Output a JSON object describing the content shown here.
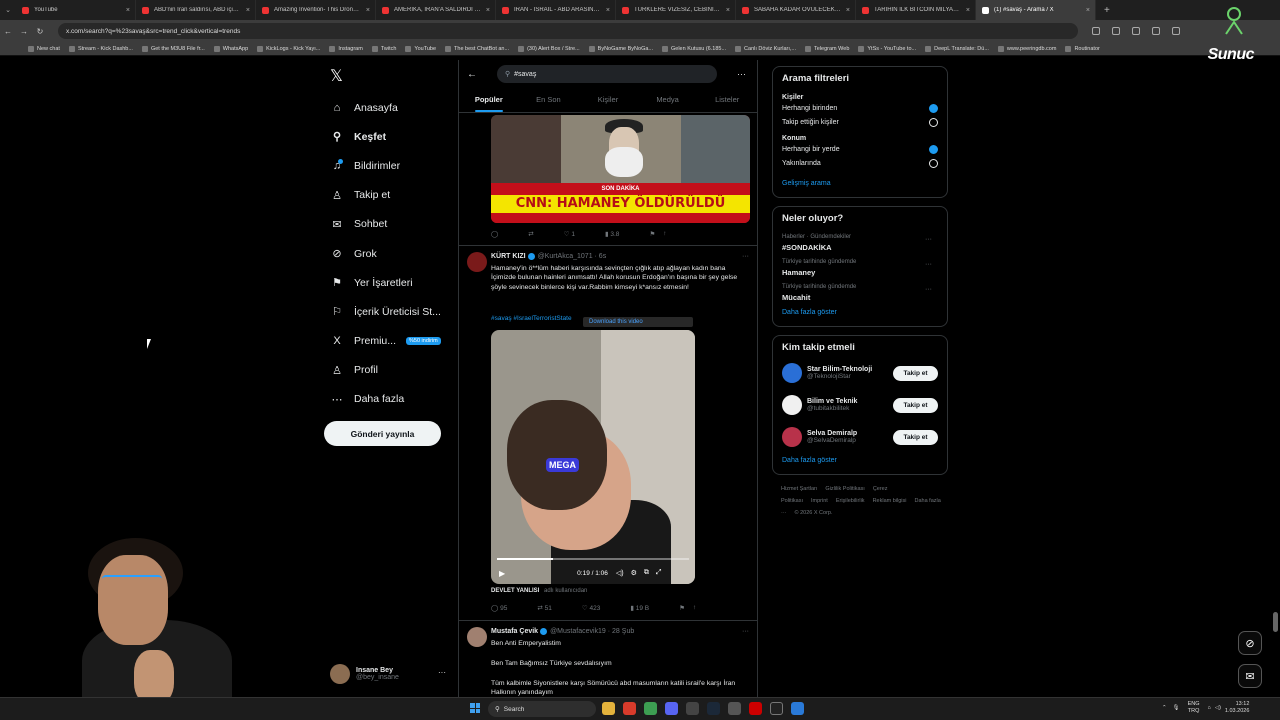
{
  "browser": {
    "tabs": [
      {
        "label": "YouTube",
        "icon": "youtube-icon"
      },
      {
        "label": "ABD'nin İran saldırısı, ABD için a...",
        "icon": "youtube-icon"
      },
      {
        "label": "Amazing Invention- This Drone ...",
        "icon": "youtube-icon"
      },
      {
        "label": "AMERİKA, İRAN'A SALDIRDI | T...",
        "icon": "youtube-icon"
      },
      {
        "label": "İRAN - İSRAİL - ABD ARASINDA...",
        "icon": "youtube-icon"
      },
      {
        "label": "TÜRKLERE VİZESİZ, CEBİNİZİ YO...",
        "icon": "youtube-icon"
      },
      {
        "label": "SABAHA KADAR ÖVÜLECEK OY...",
        "icon": "youtube-icon"
      },
      {
        "label": "TARİHİN İLK BİTCOİN MİLYARDE...",
        "icon": "youtube-icon"
      },
      {
        "label": "(1) #savaş - Arama / X",
        "icon": "x-icon",
        "active": true
      }
    ],
    "url": "x.com/search?q=%23savaş&src=trend_click&vertical=trends",
    "bookmarks": [
      "New chat",
      "Stream - Kick Dashb...",
      "Get the M3U8 File fr...",
      "WhatsApp",
      "KickLogs - Kick Yayı...",
      "Instagram",
      "Twitch",
      "YouTube",
      "The best ChatBot an...",
      "(30) Alert Box / Stre...",
      "ByNoGame ByNoGa...",
      "Gelen Kutusu (6.185...",
      "Canlı Döviz Kurları,...",
      "Telegram Web",
      "YtSs - YouTube to...",
      "DeepL Translate: Dü...",
      "www.peeringdb.com",
      "Routinator"
    ]
  },
  "overlay": {
    "brand": "Sunuc"
  },
  "nav": {
    "items": [
      {
        "label": "Anasayfa",
        "icon": "home-icon",
        "glyph": "⌂"
      },
      {
        "label": "Keşfet",
        "icon": "search-icon",
        "glyph": "⚲",
        "active": true
      },
      {
        "label": "Bildirimler",
        "icon": "bell-icon",
        "glyph": "♫"
      },
      {
        "label": "Takip et",
        "icon": "follow-icon",
        "glyph": "♙"
      },
      {
        "label": "Sohbet",
        "icon": "mail-icon",
        "glyph": "✉"
      },
      {
        "label": "Grok",
        "icon": "grok-icon",
        "glyph": "⊘"
      },
      {
        "label": "Yer İşaretleri",
        "icon": "bookmark-icon",
        "glyph": "⚑"
      },
      {
        "label": "İçerik Üreticisi St...",
        "icon": "creator-icon",
        "glyph": "⚐"
      },
      {
        "label": "Premiu...",
        "icon": "x-premium-icon",
        "glyph": "X",
        "badge": "%50 indirim"
      },
      {
        "label": "Profil",
        "icon": "profile-icon",
        "glyph": "♙"
      },
      {
        "label": "Daha fazla",
        "icon": "more-icon",
        "glyph": "⋯"
      }
    ],
    "post_button": "Gönderi yayınla",
    "user": {
      "name": "Insane Bey",
      "handle": "@bey_insane"
    }
  },
  "search": {
    "query": "#savaş",
    "tabs": [
      "Popüler",
      "En Son",
      "Kişiler",
      "Medya",
      "Listeler"
    ]
  },
  "tweet1": {
    "image_banner_top": "SON DAKİKA",
    "image_headline": "CNN: HAMANEY ÖLDÜRÜLDÜ",
    "actions": {
      "replies": "",
      "reposts": "",
      "likes": "1",
      "views": "3.8"
    }
  },
  "tweet2": {
    "name": "KÜRT KIZI",
    "handle": "@KurtAkca_1071 · 6s",
    "text": "Hamaney'in ö**lüm haberi karşısında sevinçten çığlık atıp ağlayan kadın bana İçimizde bulunan hainleri anımsattı! Allah korusun Erdoğan'ın başına bir şey gelse şöyle sevinecek binlerce kişi var.Rabbim kimseyi k*ansız etmesin!",
    "hashtags": "#savaş #IsraelTerroristState",
    "download_label": "Download this video",
    "video_time": "0:19 / 1:06",
    "video_progress": 0.29,
    "source_name": "DEVLET YANLISI",
    "source_by": "adlı kullanıcıdan",
    "actions": {
      "replies": "95",
      "reposts": "51",
      "likes": "423",
      "views": "19 B"
    }
  },
  "tweet3": {
    "name": "Mustafa Çevik",
    "handle": "@Mustafacevik19 · 28 Şub",
    "lines": [
      "Ben Anti Emperyalistim",
      "Ben Tam Bağımsız Türkiye sevdalısıyım",
      "Tüm kalbimle Siyonistlere karşı Sömürücü abd masumların katili israil'e karşı İran Halkının yanındayım"
    ]
  },
  "right": {
    "filters": {
      "title": "Arama filtreleri",
      "people_heading": "Kişiler",
      "people_options": [
        {
          "label": "Herhangi birinden",
          "on": true
        },
        {
          "label": "Takip ettiğin kişiler",
          "on": false
        }
      ],
      "location_heading": "Konum",
      "location_options": [
        {
          "label": "Herhangi bir yerde",
          "on": true
        },
        {
          "label": "Yakınlarında",
          "on": false
        }
      ],
      "advanced": "Gelişmiş arama"
    },
    "trends": {
      "title": "Neler oluyor?",
      "items": [
        {
          "context": "Haberler · Gündemdekiler",
          "name": "#SONDAKİKA"
        },
        {
          "context": "Türkiye tarihinde gündemde",
          "name": "Hamaney"
        },
        {
          "context": "Türkiye tarihinde gündemde",
          "name": "Mücahit"
        }
      ],
      "more": "Daha fazla göster"
    },
    "who_to_follow": {
      "title": "Kim takip etmeli",
      "items": [
        {
          "name": "Star Bilim-Teknoloji",
          "handle": "@TeknolojiStar",
          "button": "Takip et",
          "color": "#2a6fd6"
        },
        {
          "name": "Bilim ve Teknik",
          "handle": "@tubitakbilitek",
          "button": "Takip et",
          "color": "#f0f0f0"
        },
        {
          "name": "Selva Demiralp",
          "handle": "@SelvaDemiralp",
          "button": "Takip et",
          "color": "#b8324a"
        }
      ],
      "more": "Daha fazla göster"
    },
    "footer": [
      "Hizmet Şartları",
      "Gizlilik Politikası",
      "Çerez Politikası",
      "Imprint",
      "Erişilebilirlik",
      "Reklam bilgisi",
      "Daha fazla ···",
      "© 2026 X Corp."
    ]
  },
  "taskbar": {
    "search": "Search",
    "lang_line1": "ENG",
    "lang_line2": "TRQ",
    "time": "13:12",
    "date": "1.03.2026"
  },
  "colors": {
    "accent": "#1d9bf0",
    "background": "#000000"
  }
}
